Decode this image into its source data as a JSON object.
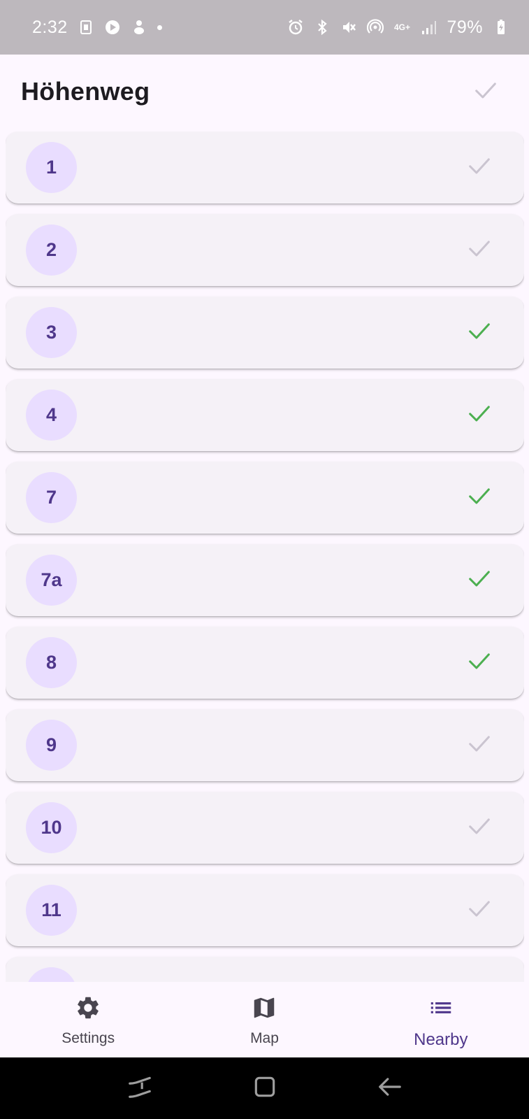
{
  "status_bar": {
    "time": "2:32",
    "network_label": "4G+",
    "battery": "79%",
    "icons": [
      "sim-icon",
      "play-games-icon",
      "app-icon",
      "notification-dot",
      "alarm-icon",
      "bluetooth-icon",
      "vibrate-icon",
      "hotspot-icon",
      "network-4g-icon",
      "signal-icon",
      "battery-charging-icon"
    ]
  },
  "app_bar": {
    "title": "Höhenweg",
    "action_icon": "check-icon"
  },
  "colors": {
    "done": "#4caf50",
    "pending": "#cac4d0",
    "avatar_bg": "#e9ddff",
    "avatar_text": "#4f378b",
    "card_bg": "#f5f1f7"
  },
  "items": [
    {
      "label": "1",
      "done": false
    },
    {
      "label": "2",
      "done": false
    },
    {
      "label": "3",
      "done": true
    },
    {
      "label": "4",
      "done": true
    },
    {
      "label": "7",
      "done": true
    },
    {
      "label": "7a",
      "done": true
    },
    {
      "label": "8",
      "done": true
    },
    {
      "label": "9",
      "done": false
    },
    {
      "label": "10",
      "done": false
    },
    {
      "label": "11",
      "done": false
    },
    {
      "label": "",
      "done": false
    }
  ],
  "bottom_nav": {
    "items": [
      {
        "label": "Settings",
        "icon": "gear-icon",
        "active": false
      },
      {
        "label": "Map",
        "icon": "map-icon",
        "active": false
      },
      {
        "label": "Nearby",
        "icon": "list-icon",
        "active": true
      }
    ]
  },
  "system_nav": {
    "buttons": [
      "recent-apps-icon",
      "home-icon",
      "back-icon"
    ]
  }
}
